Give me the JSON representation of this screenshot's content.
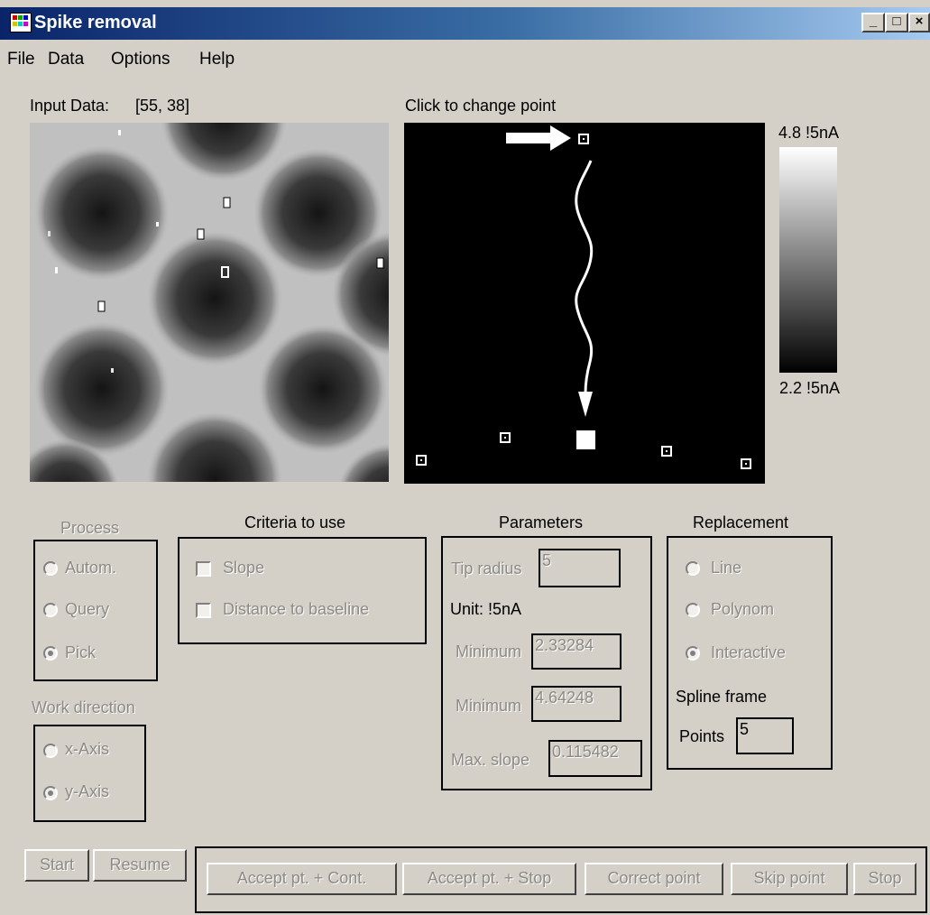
{
  "window": {
    "title": "Spike removal",
    "minimize": "_",
    "maximize": "□",
    "close": "×"
  },
  "menu": [
    "File",
    "Data",
    "Options",
    "Help"
  ],
  "input_panel": {
    "label": "Input Data:",
    "coords": "[55, 38]"
  },
  "pick_panel": {
    "label": "Click to change point"
  },
  "colorbar": {
    "max": "4.8 !5nA",
    "min": "2.2 !5nA"
  },
  "process": {
    "title": "Process",
    "options": [
      "Autom.",
      "Query",
      "Pick"
    ],
    "selected": "Pick"
  },
  "work_direction": {
    "title": "Work direction",
    "options": [
      "x-Axis",
      "y-Axis"
    ],
    "selected": "y-Axis"
  },
  "criteria": {
    "title": "Criteria to use",
    "options": [
      "Slope",
      "Distance to baseline"
    ]
  },
  "parameters": {
    "title": "Parameters",
    "tip_radius_label": "Tip radius",
    "tip_radius": "5",
    "unit_label": "Unit: !5nA",
    "minimum_label_1": "Minimum",
    "minimum_1": "2.33284",
    "minimum_label_2": "Minimum",
    "minimum_2": "4.64248",
    "max_slope_label": "Max. slope",
    "max_slope": "0.115482"
  },
  "replacement": {
    "title": "Replacement",
    "options": [
      "Line",
      "Polynom",
      "Interactive"
    ],
    "selected": "Interactive",
    "spline_label": "Spline frame",
    "points_label": "Points",
    "points": "5"
  },
  "buttons": {
    "start": "Start",
    "resume": "Resume",
    "accept_cont": "Accept pt. + Cont.",
    "accept_stop": "Accept pt. + Stop",
    "correct": "Correct point",
    "skip": "Skip point",
    "stop": "Stop"
  }
}
